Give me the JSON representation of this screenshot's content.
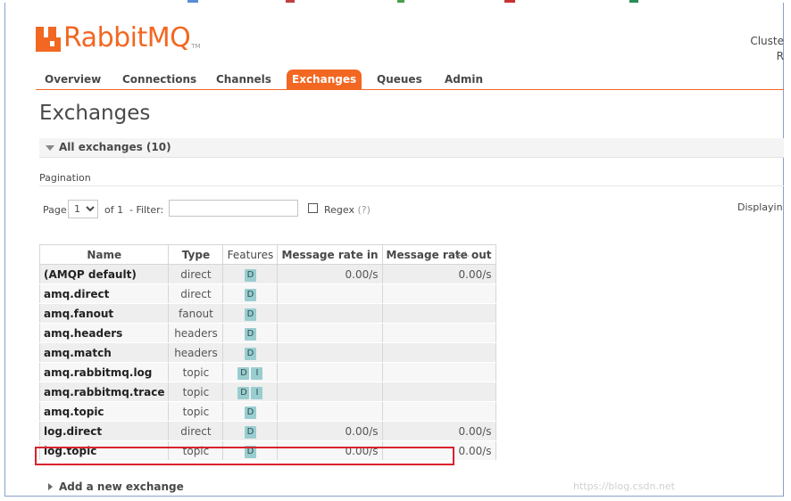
{
  "brand": {
    "name": "RabbitMQ",
    "tm": "TM",
    "color": "#f26722"
  },
  "cluster": {
    "label": "Cluste",
    "line2": "R"
  },
  "nav": {
    "tabs": [
      {
        "label": "Overview",
        "active": false
      },
      {
        "label": "Connections",
        "active": false
      },
      {
        "label": "Channels",
        "active": false
      },
      {
        "label": "Exchanges",
        "active": true
      },
      {
        "label": "Queues",
        "active": false
      },
      {
        "label": "Admin",
        "active": false
      }
    ]
  },
  "page": {
    "title": "Exchanges"
  },
  "section": {
    "label": "All exchanges (10)",
    "icon": "collapse-triangle-icon"
  },
  "pagination": {
    "title": "Pagination",
    "page_label": "Page",
    "page_value": "1",
    "page_options": [
      "1"
    ],
    "of_label": "of 1",
    "filter_label": "- Filter:",
    "filter_value": "",
    "regex_label": "Regex",
    "regex_help": "(?)",
    "regex_checked": false,
    "displaying": "Displayin"
  },
  "table": {
    "columns": [
      "Name",
      "Type",
      "Features",
      "Message rate in",
      "Message rate out"
    ],
    "toggle": "+/-",
    "rows": [
      {
        "name": "(AMQP default)",
        "type": "direct",
        "features": [
          "D"
        ],
        "rate_in": "0.00/s",
        "rate_out": "0.00/s"
      },
      {
        "name": "amq.direct",
        "type": "direct",
        "features": [
          "D"
        ],
        "rate_in": "",
        "rate_out": ""
      },
      {
        "name": "amq.fanout",
        "type": "fanout",
        "features": [
          "D"
        ],
        "rate_in": "",
        "rate_out": ""
      },
      {
        "name": "amq.headers",
        "type": "headers",
        "features": [
          "D"
        ],
        "rate_in": "",
        "rate_out": ""
      },
      {
        "name": "amq.match",
        "type": "headers",
        "features": [
          "D"
        ],
        "rate_in": "",
        "rate_out": ""
      },
      {
        "name": "amq.rabbitmq.log",
        "type": "topic",
        "features": [
          "D",
          "I"
        ],
        "rate_in": "",
        "rate_out": ""
      },
      {
        "name": "amq.rabbitmq.trace",
        "type": "topic",
        "features": [
          "D",
          "I"
        ],
        "rate_in": "",
        "rate_out": ""
      },
      {
        "name": "amq.topic",
        "type": "topic",
        "features": [
          "D"
        ],
        "rate_in": "",
        "rate_out": ""
      },
      {
        "name": "log.direct",
        "type": "direct",
        "features": [
          "D"
        ],
        "rate_in": "0.00/s",
        "rate_out": "0.00/s"
      },
      {
        "name": "log.topic",
        "type": "topic",
        "features": [
          "D"
        ],
        "rate_in": "0.00/s",
        "rate_out": "0.00/s"
      }
    ]
  },
  "add_exchange": {
    "label": "Add a new exchange",
    "icon": "expand-triangle-icon"
  },
  "watermark": "https://blog.csdn.net",
  "colors": {
    "accent": "#f26722",
    "badge": "#99cdd0",
    "highlight": "#d9232d"
  }
}
